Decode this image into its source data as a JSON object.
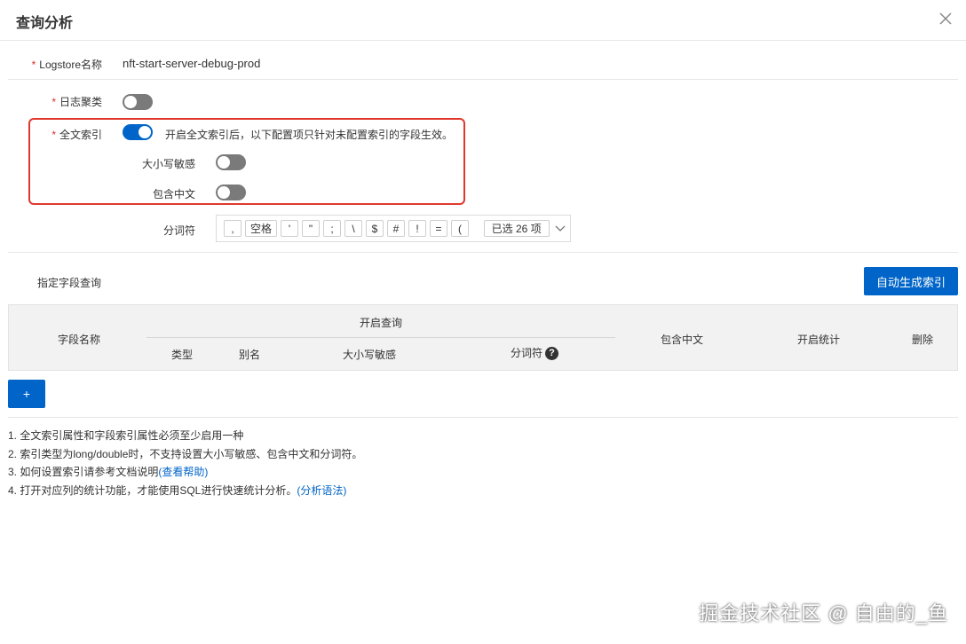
{
  "dialog": {
    "title": "查询分析",
    "close_icon": "close-icon"
  },
  "form": {
    "logstore_label": "Logstore名称",
    "logstore_value": "nft-start-server-debug-prod",
    "log_cluster_label": "日志聚类",
    "log_cluster_on": false,
    "fulltext_label": "全文索引",
    "fulltext_on": true,
    "fulltext_hint": "开启全文索引后，以下配置项只针对未配置索引的字段生效。",
    "case_sensitive_label": "大小写敏感",
    "case_sensitive_on": false,
    "include_chinese_label": "包含中文",
    "include_chinese_on": false,
    "delimiter_label": "分词符",
    "delimiters": [
      ",",
      "空格",
      "'",
      "\"",
      ";",
      "\\",
      "$",
      "#",
      "!",
      "=",
      "("
    ],
    "delimiter_selected": "已选 26 项",
    "required_mark": "*"
  },
  "field_query": {
    "label": "指定字段查询",
    "auto_generate_button": "自动生成索引",
    "add_button": "+"
  },
  "table": {
    "col_field_name": "字段名称",
    "group_enable_query": "开启查询",
    "col_type": "类型",
    "col_alias": "别名",
    "col_case_sensitive": "大小写敏感",
    "col_delimiter": "分词符",
    "help_mark": "?",
    "col_include_chinese": "包含中文",
    "col_enable_stats": "开启统计",
    "col_delete": "删除"
  },
  "notes": {
    "n1": "1. 全文索引属性和字段索引属性必须至少启用一种",
    "n2": "2. 索引类型为long/double时，不支持设置大小写敏感、包含中文和分词符。",
    "n3": "3. 如何设置索引请参考文档说明",
    "n3_link": "(查看帮助)",
    "n4": "4. 打开对应列的统计功能，才能使用SQL进行快速统计分析。",
    "n4_link": "(分析语法)"
  },
  "watermark": "掘金技术社区 @ 自由的_鱼"
}
